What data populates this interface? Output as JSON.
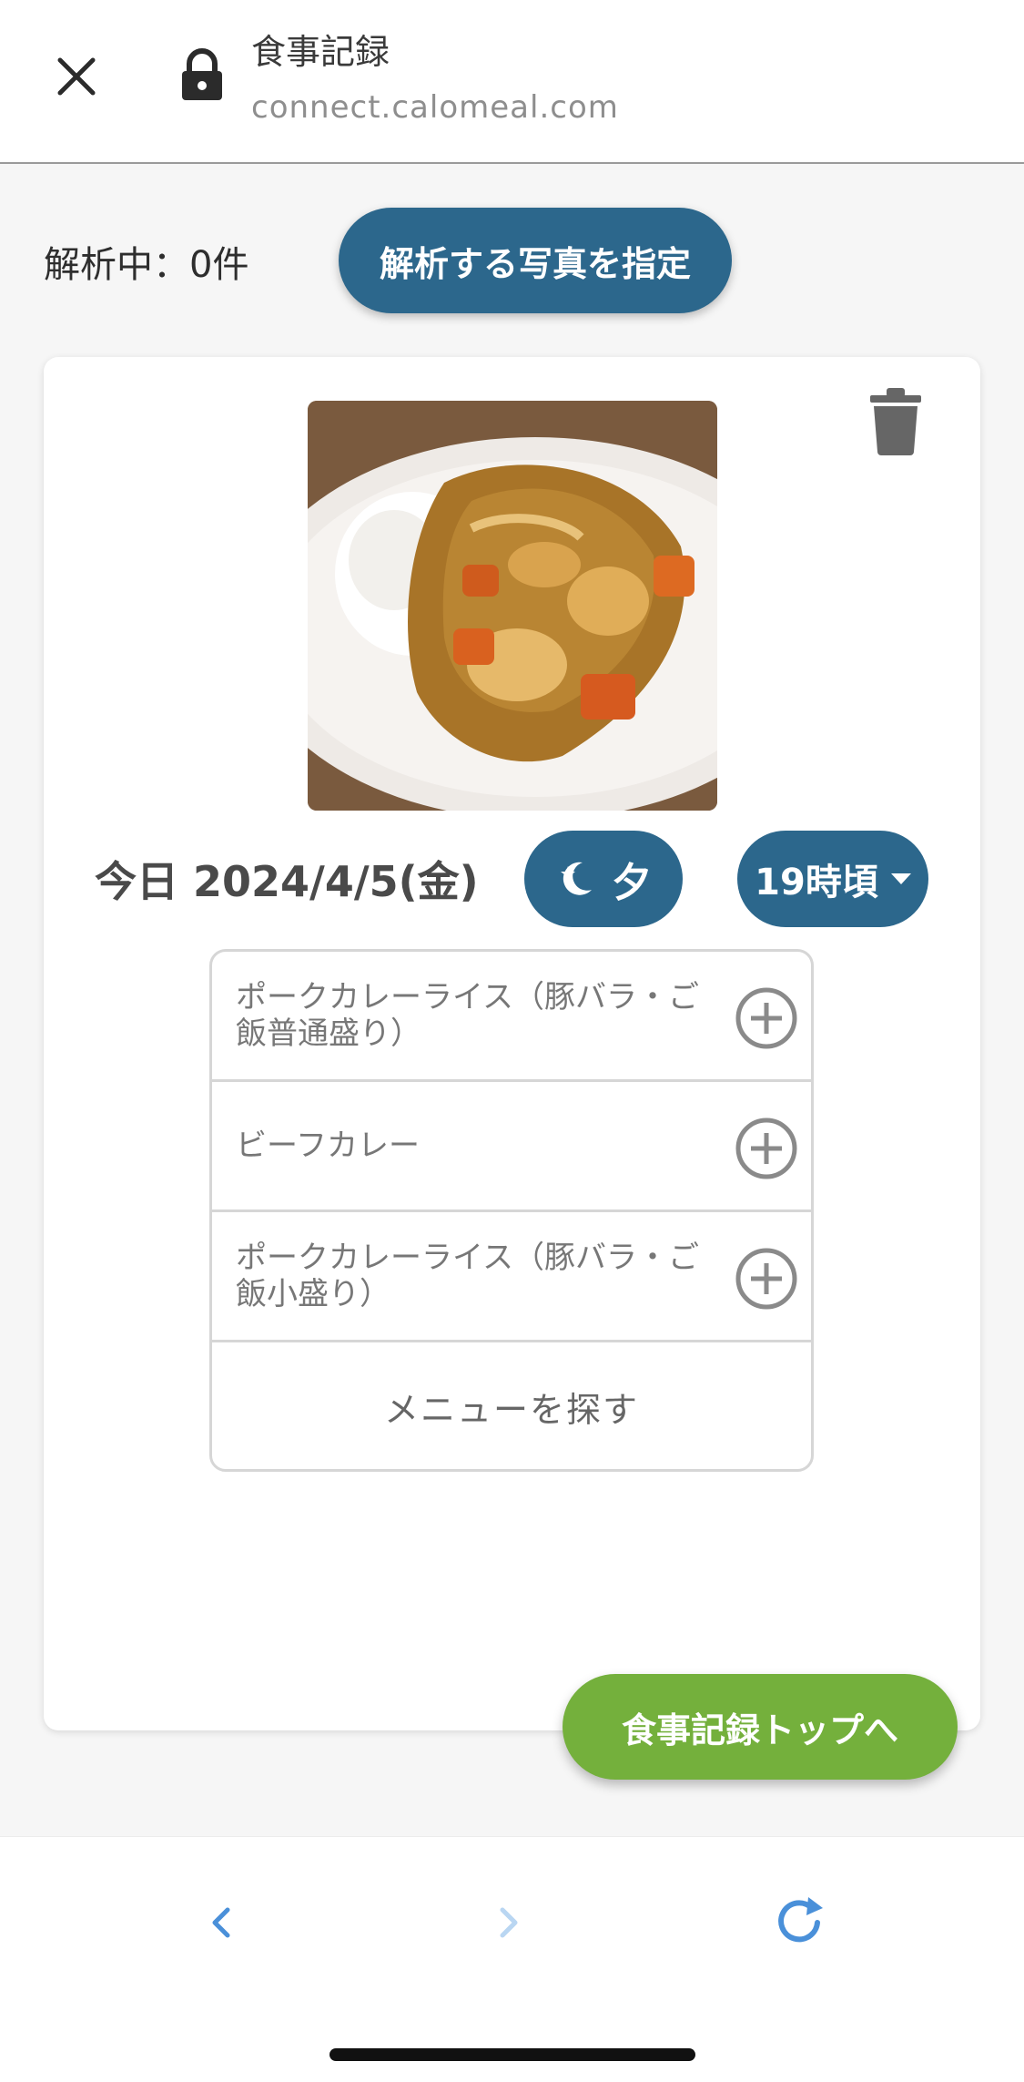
{
  "header": {
    "title": "食事記録",
    "url": "connect.calomeal.com",
    "close_icon": "close-icon",
    "lock_icon": "lock-icon"
  },
  "analysis": {
    "status": "解析中：0件",
    "pick_photo_label": "解析する写真を指定"
  },
  "entry": {
    "date": "今日 2024/4/5(金)",
    "meal_label": "夕",
    "meal_icon": "moon-star-icon",
    "time_label": "19時頃"
  },
  "menu": {
    "items": [
      {
        "label": "ポークカレーライス（豚バラ・ご飯普通盛り）"
      },
      {
        "label": "ビーフカレー"
      },
      {
        "label": "ポークカレーライス（豚バラ・ご飯小盛り）"
      }
    ],
    "search_label": "メニューを探す"
  },
  "actions": {
    "top_label": "食事記録トップへ"
  },
  "colors": {
    "primary": "#2c678c",
    "accent_green": "#74b03c",
    "nav_blue": "#4a90d9"
  }
}
